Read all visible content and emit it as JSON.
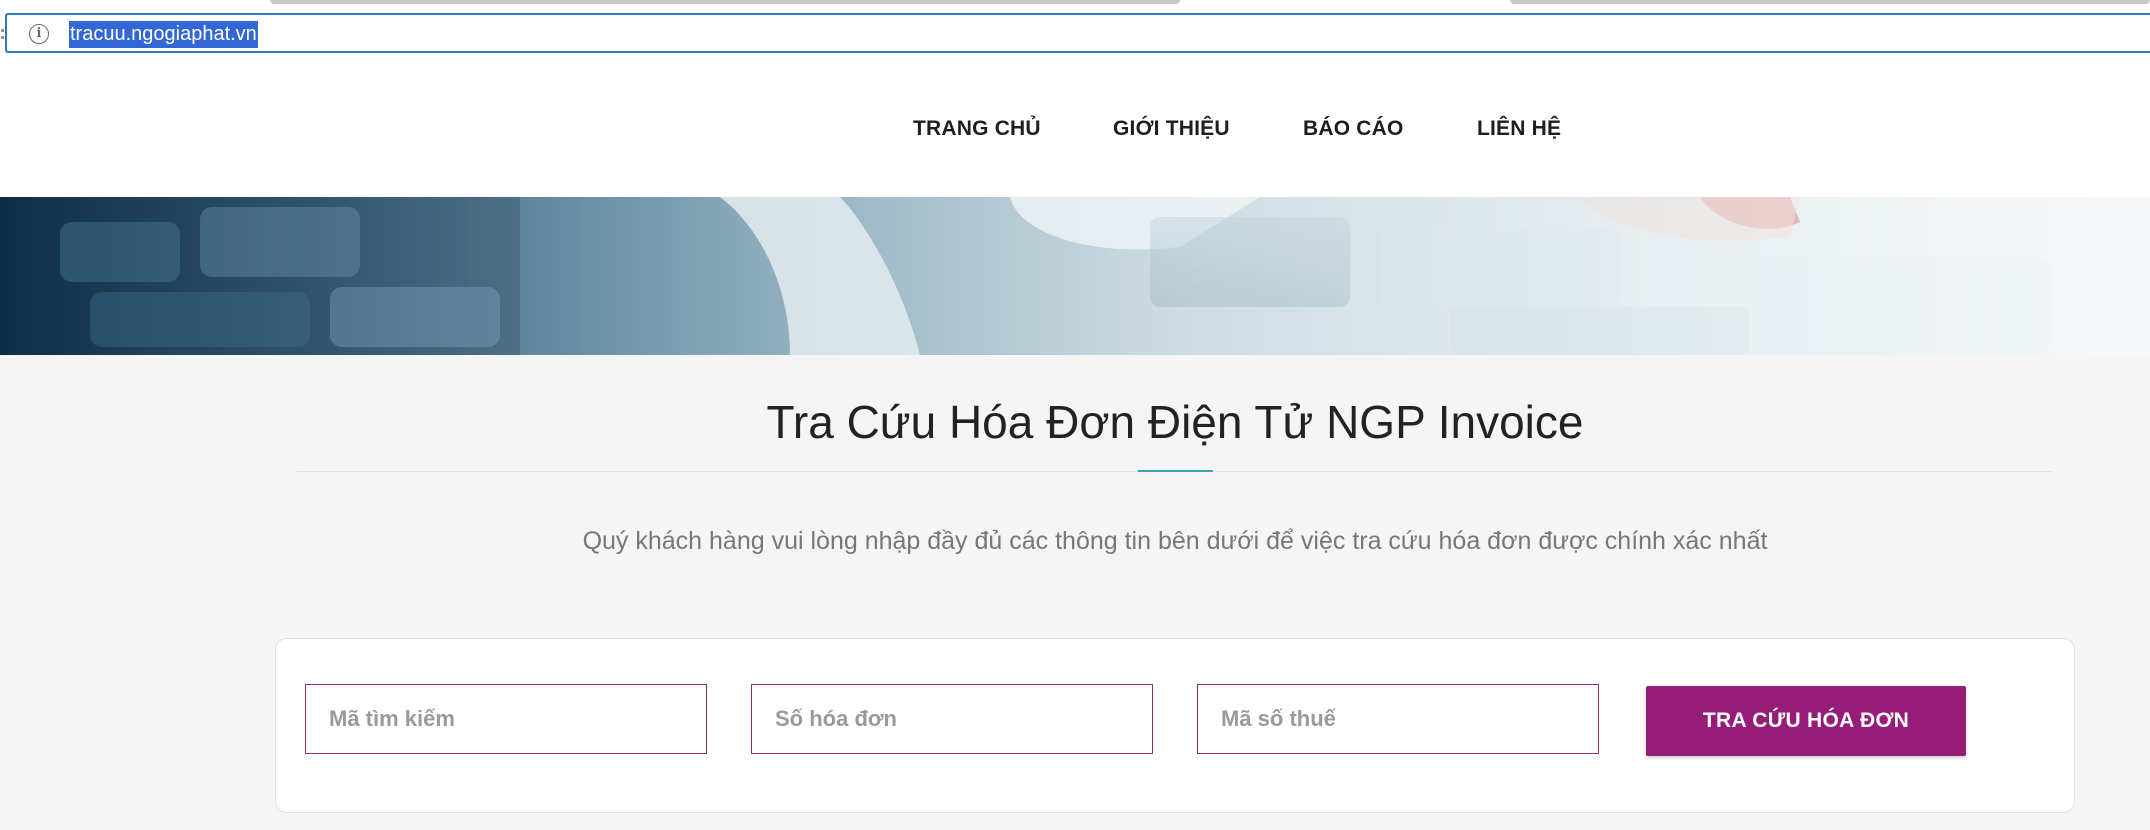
{
  "browser": {
    "url": "tracuu.ngogiaphat.vn",
    "info_icon": "i"
  },
  "nav": {
    "items": [
      {
        "label": "TRANG CHỦ"
      },
      {
        "label": "GIỚI THIỆU"
      },
      {
        "label": "BÁO CÁO"
      },
      {
        "label": "LIÊN HỆ"
      }
    ]
  },
  "main": {
    "title": "Tra Cứu Hóa Đơn Điện Tử NGP Invoice",
    "subtitle": "Quý khách hàng vui lòng nhập đầy đủ các thông tin bên dưới để việc tra cứu hóa đơn được chính xác nhất"
  },
  "search": {
    "code_placeholder": "Mã tìm kiếm",
    "invoice_number_placeholder": "Số hóa đơn",
    "tax_code_placeholder": "Mã số thuế",
    "button_label": "TRA CỨU HÓA ĐƠN"
  },
  "colors": {
    "accent": "#951d78",
    "url_highlight": "#3367d6",
    "title_accent": "#35a7b9"
  },
  "icons": {
    "info": "info-icon",
    "banner": "banner-image"
  }
}
